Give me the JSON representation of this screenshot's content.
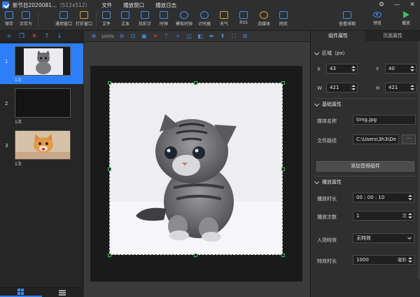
{
  "window": {
    "title": "新节目2020081...",
    "size": "（512x512）",
    "menus": [
      "文件",
      "播放窗口",
      "播放日志"
    ],
    "controls": [
      "⚙",
      "—",
      "✕"
    ]
  },
  "toolbar": {
    "items": [
      {
        "label": "保存",
        "icon": "save-icon"
      },
      {
        "label": "另存为",
        "icon": "save-as-icon"
      },
      {
        "label": "通用窗口",
        "icon": "window-icon"
      },
      {
        "label": "打折窗口",
        "icon": "split-window-icon"
      },
      {
        "label": "文件",
        "icon": "folder-icon"
      },
      {
        "label": "文本",
        "icon": "text-icon"
      },
      {
        "label": "炫彩字",
        "icon": "color-text-icon"
      },
      {
        "label": "时钟",
        "icon": "clock-icon"
      },
      {
        "label": "模拟时钟",
        "icon": "analog-clock-icon"
      },
      {
        "label": "计时器",
        "icon": "timer-icon"
      },
      {
        "label": "天气",
        "icon": "weather-icon"
      },
      {
        "label": "RSS",
        "icon": "rss-icon"
      },
      {
        "label": "流媒体",
        "icon": "streaming-icon"
      },
      {
        "label": "网页",
        "icon": "webpage-icon"
      }
    ],
    "right_items": [
      {
        "label": "查看排期",
        "icon": "schedule-icon"
      },
      {
        "label": "预览",
        "icon": "preview-icon"
      },
      {
        "label": "播放",
        "icon": "play-icon"
      }
    ]
  },
  "left_tools": [
    "+",
    "❐",
    "✕",
    "↑",
    "↓"
  ],
  "slides": [
    {
      "num": "1",
      "count": "1次",
      "kind": "kitten"
    },
    {
      "num": "2",
      "count": "1次",
      "kind": "black"
    },
    {
      "num": "3",
      "count": "1次",
      "kind": "orange-cat"
    }
  ],
  "canvas_tools": {
    "zoom": "100%"
  },
  "properties": {
    "tabs": [
      "组件属性",
      "页面属性"
    ],
    "region": {
      "title": "区域（px）",
      "x_label": "X",
      "x": "43",
      "y_label": "Y",
      "y": "40",
      "w_label": "W",
      "w": "421",
      "h_label": "H",
      "h": "421"
    },
    "basic": {
      "title": "基础属性",
      "media_name_label": "媒体名称",
      "media_name": "timg.jpg",
      "file_path_label": "文件路径",
      "file_path": "C:\\Users\\3h3\\De",
      "browse": "···",
      "add_audio": "添加音频组件"
    },
    "playback": {
      "title": "播放属性",
      "duration_label": "播放时长",
      "duration": "00 : 00 : 10",
      "times_label": "播放次数",
      "times": "1",
      "times_unit": "次",
      "enter_effect_label": "入场特效",
      "enter_effect": "无特效",
      "effect_duration_label": "特效时长",
      "effect_duration": "1000",
      "effect_duration_unit": "毫秒"
    }
  },
  "colors": {
    "accent": "#2d7ff9",
    "play": "#3fbf5a",
    "delete": "#e04a4a"
  }
}
